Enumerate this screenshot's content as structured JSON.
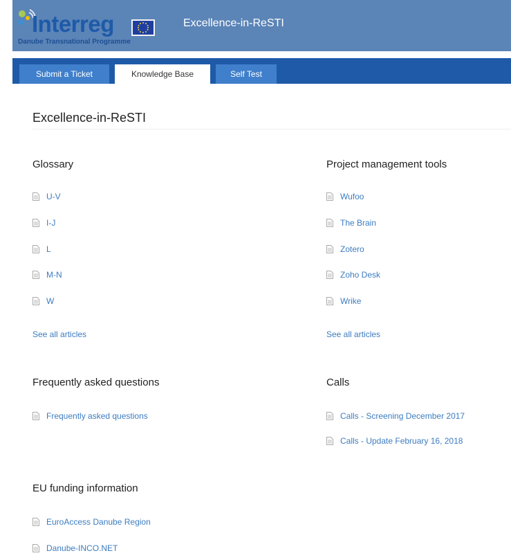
{
  "header": {
    "logo_text": "Interreg",
    "logo_subtitle": "Danube Transnational Programme",
    "title": "Excellence-in-ReSTI"
  },
  "tabs": [
    {
      "label": "Submit a Ticket"
    },
    {
      "label": "Knowledge Base"
    },
    {
      "label": "Self Test"
    }
  ],
  "page": {
    "title": "Excellence-in-ReSTI"
  },
  "sections": {
    "glossary": {
      "title": "Glossary",
      "articles": [
        "U-V",
        "I-J",
        "L",
        "M-N",
        "W"
      ],
      "see_all": "See all articles"
    },
    "project_tools": {
      "title": "Project management tools",
      "articles": [
        "Wufoo",
        "The Brain",
        "Zotero",
        "Zoho Desk",
        "Wrike"
      ],
      "see_all": "See all articles"
    },
    "faq": {
      "title": "Frequently asked questions",
      "articles": [
        "Frequently asked questions"
      ]
    },
    "calls": {
      "title": "Calls",
      "articles": [
        "Calls - Screening December 2017",
        "Calls - Update February 16, 2018"
      ]
    },
    "eu_funding": {
      "title": "EU funding information",
      "articles": [
        "EuroAccess Danube Region",
        "Danube-INCO.NET"
      ]
    }
  },
  "colors": {
    "header_bg": "#5b84b7",
    "tabbar_bg": "#1e5aa8",
    "tab_bg": "#3f7fcb",
    "link": "#3c7cc0"
  }
}
